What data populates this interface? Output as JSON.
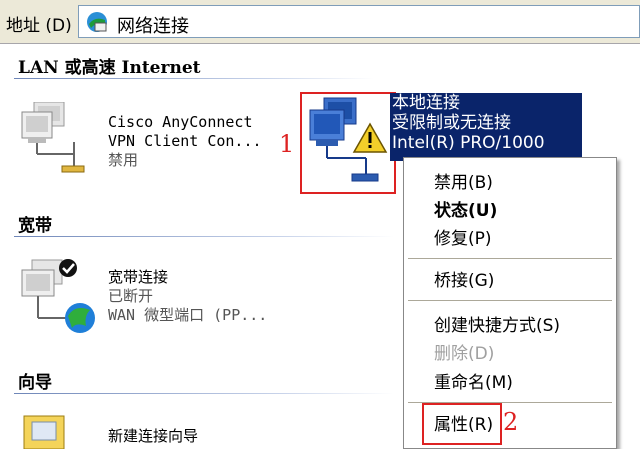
{
  "address_bar": {
    "label": "地址 (D)",
    "location": "网络连接"
  },
  "sections": {
    "lan": {
      "title": "LAN 或高速 Internet"
    },
    "broadband": {
      "title": "宽带"
    },
    "wizard": {
      "title": "向导"
    }
  },
  "items": {
    "cisco": {
      "name": "Cisco AnyConnect",
      "name2": "VPN Client Con...",
      "status": "禁用"
    },
    "local": {
      "name": "本地连接",
      "status": "受限制或无连接",
      "device": "Intel(R) PRO/1000"
    },
    "broadband": {
      "name": "宽带连接",
      "status": "已断开",
      "device": "WAN 微型端口 (PP..."
    },
    "wizard": {
      "name": "新建连接向导"
    }
  },
  "context_menu": {
    "disable": "禁用(B)",
    "status": "状态(U)",
    "repair": "修复(P)",
    "bridge": "桥接(G)",
    "shortcut": "创建快捷方式(S)",
    "delete": "删除(D)",
    "rename": "重命名(M)",
    "properties": "属性(R)"
  },
  "annotations": {
    "one": "1",
    "two": "2"
  },
  "colors": {
    "selection": "#0a246a",
    "annotation": "#dd2222",
    "window_bg": "#ece9d8"
  }
}
